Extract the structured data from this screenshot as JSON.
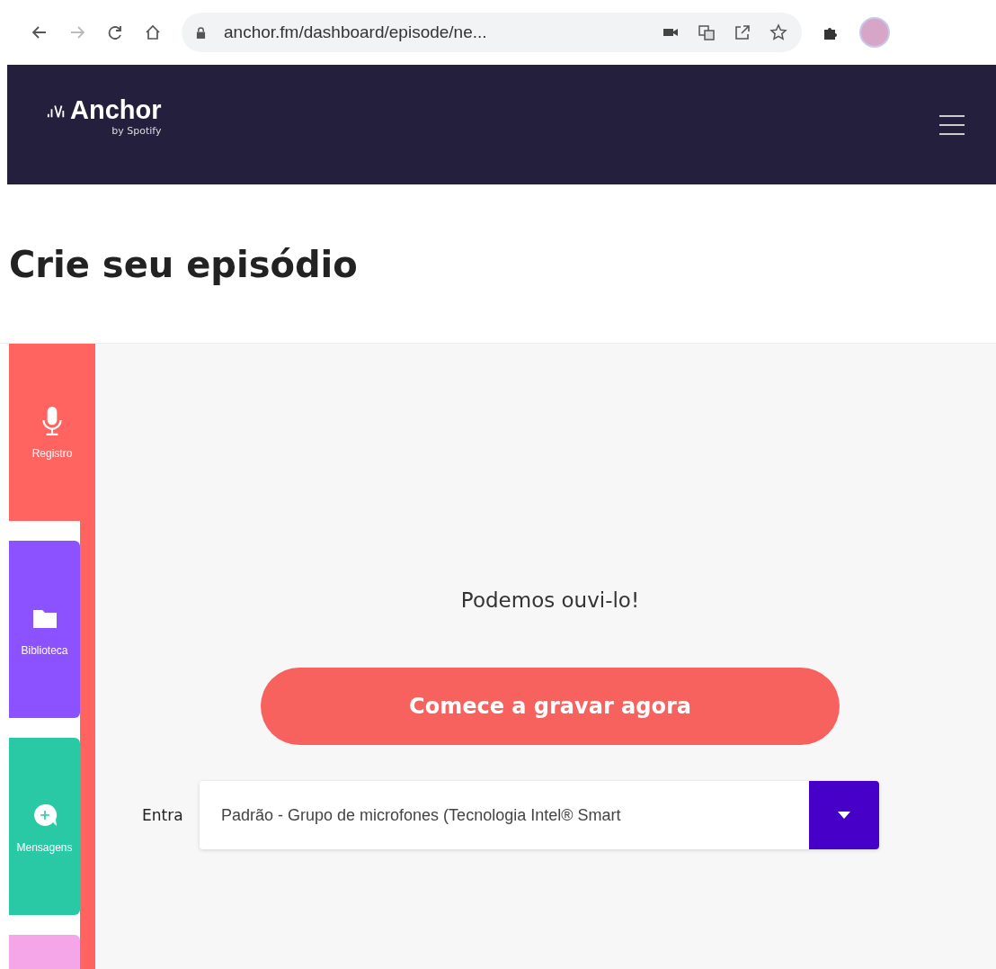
{
  "browser": {
    "url": "anchor.fm/dashboard/episode/ne..."
  },
  "header": {
    "brand": "Anchor",
    "tagline": "by Spotify"
  },
  "page_title": "Crie seu episódio",
  "sidebar": {
    "items": [
      {
        "label": "Registro",
        "kind": "mic",
        "color": "#ff6461",
        "selected": true
      },
      {
        "label": "Biblioteca",
        "kind": "folder",
        "color": "#8c52ff",
        "selected": false
      },
      {
        "label": "Mensagens",
        "kind": "message",
        "color": "#2ac9a6",
        "selected": false
      },
      {
        "kind": "blank",
        "color": "#f4a6e8",
        "selected": false
      }
    ]
  },
  "recorder": {
    "status": "Podemos ouvi-lo!",
    "record_button": "Comece a gravar agora",
    "input_label": "Entra",
    "input_value": "Padrão - Grupo de microfones (Tecnologia Intel® Smart"
  }
}
